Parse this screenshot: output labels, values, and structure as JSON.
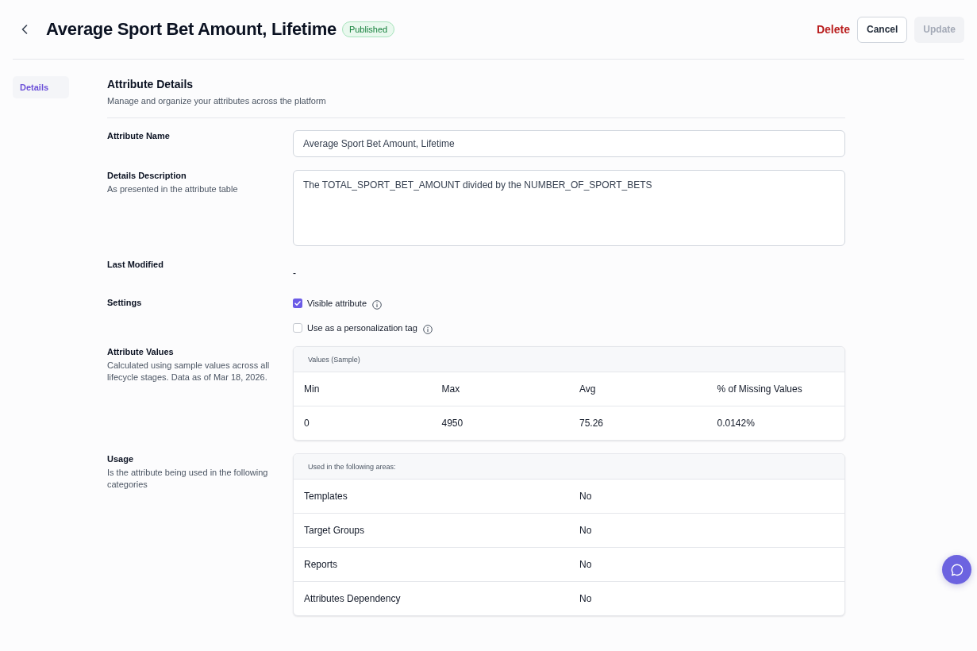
{
  "header": {
    "title": "Average Sport Bet Amount, Lifetime",
    "status_badge": "Published",
    "actions": [
      {
        "label": "Delete",
        "kind": "danger",
        "disabled": false
      },
      {
        "label": "Cancel",
        "kind": "outline",
        "disabled": false
      },
      {
        "label": "Update",
        "kind": "primary",
        "disabled": true
      }
    ]
  },
  "sidebar": {
    "items": [
      {
        "label": "Details",
        "selected": true
      }
    ]
  },
  "section": {
    "title": "Attribute Details",
    "subtitle": "Manage and organize your attributes across the platform"
  },
  "fields": [
    {
      "kind": "input",
      "label": "Attribute Name",
      "value": "Average Sport Bet Amount, Lifetime"
    },
    {
      "kind": "textarea",
      "label": "Details Description",
      "hint": "As presented in the attribute table",
      "value": "The TOTAL_SPORT_BET_AMOUNT divided by the NUMBER_OF_SPORT_BETS"
    },
    {
      "kind": "text",
      "label": "Last Modified",
      "value": "-"
    },
    {
      "kind": "checkboxes",
      "label": "Settings",
      "options": [
        {
          "label": "Visible attribute",
          "checked": true
        },
        {
          "label": "Use as a personalization tag",
          "checked": false
        }
      ]
    },
    {
      "kind": "stats",
      "label": "Attribute Values",
      "hint": "Calculated using sample values across all lifecycle stages. Data as of Mar 18, 2026.",
      "table": {
        "caption": "Values (Sample)",
        "columns": [
          "Min",
          "Max",
          "Avg",
          "% of Missing Values"
        ],
        "rows": [
          [
            "0",
            "4950",
            "75.26",
            "0.0142%"
          ]
        ]
      }
    },
    {
      "kind": "usage",
      "label": "Usage",
      "hint": "Is the attribute being used in the following categories",
      "table": {
        "caption": "Used in the following areas:",
        "rows": [
          {
            "area": "Templates",
            "value": "No"
          },
          {
            "area": "Target Groups",
            "value": "No"
          },
          {
            "area": "Reports",
            "value": "No"
          },
          {
            "area": "Attributes Dependency",
            "value": "No"
          }
        ]
      }
    }
  ]
}
